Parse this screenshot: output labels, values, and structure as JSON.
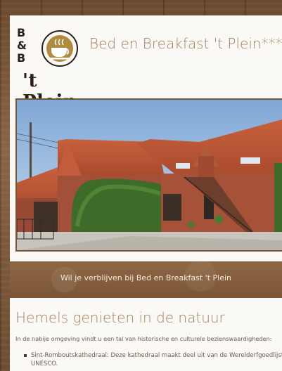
{
  "logo": {
    "b1": "B",
    "amp": "&",
    "b2": "B",
    "name": "'t Plein",
    "icon": "coffee-cup-icon"
  },
  "header": {
    "title": "Bed en Breakfast 't Plein***"
  },
  "hero": {
    "image": "farmhouse-courtyard-photo"
  },
  "banner": {
    "text": "Wil je verblijven bij Bed en Breakfast 't Plein"
  },
  "section": {
    "heading": "Hemels genieten in de natuur",
    "intro": "In de nabije omgeving vindt u een tal van historische en culturele bezienswaardigheden:",
    "items": [
      {
        "line1": "Sint-Romboutskathedraal: Deze kathedraal maakt deel uit van de Werelderfgoedlijst",
        "line2": "UNESCO."
      }
    ]
  },
  "colors": {
    "accent": "#a67f5c",
    "wood": "#7a5638",
    "text": "#6a5a4a"
  }
}
